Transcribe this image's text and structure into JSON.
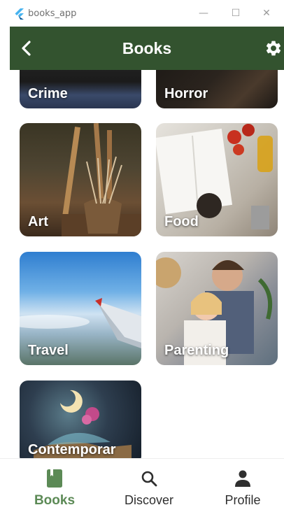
{
  "window": {
    "title": "books_app",
    "min_glyph": "—",
    "max_glyph": "☐",
    "close_glyph": "✕"
  },
  "appbar": {
    "title": "Books",
    "back_icon": "chevron-left-icon",
    "settings_icon": "gear-icon"
  },
  "categories": [
    {
      "label": "Crime"
    },
    {
      "label": "Horror"
    },
    {
      "label": "Art"
    },
    {
      "label": "Food"
    },
    {
      "label": "Travel"
    },
    {
      "label": "Parenting"
    },
    {
      "label": "Contemporar"
    }
  ],
  "bottom_nav": {
    "items": [
      {
        "label": "Books",
        "icon": "book-icon",
        "active": true
      },
      {
        "label": "Discover",
        "icon": "search-icon",
        "active": false
      },
      {
        "label": "Profile",
        "icon": "person-icon",
        "active": false
      }
    ]
  },
  "colors": {
    "appbar": "#33532f",
    "active_nav": "#5c8a56",
    "inactive_nav": "#2f2f2f"
  }
}
